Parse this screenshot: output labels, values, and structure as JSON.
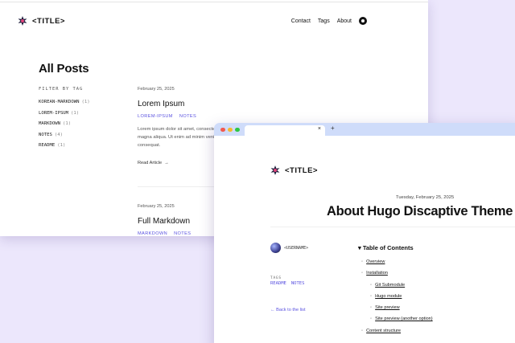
{
  "site": {
    "logo_text": "<TITLE>"
  },
  "back_window": {
    "nav": {
      "items": [
        "Contact",
        "Tags",
        "About"
      ]
    },
    "page_title": "All Posts",
    "filter_title": "FILTER BY TAG",
    "tags": [
      {
        "name": "KOREAN-MARKDOWN",
        "count": "(1)"
      },
      {
        "name": "LOREM-IPSUM",
        "count": "(1)"
      },
      {
        "name": "MARKDOWN",
        "count": "(1)"
      },
      {
        "name": "NOTES",
        "count": "(4)"
      },
      {
        "name": "README",
        "count": "(1)"
      }
    ],
    "posts": [
      {
        "date": "February 25, 2025",
        "title": "Lorem Ipsum",
        "tags": [
          "LOREM-IPSUM",
          "NOTES"
        ],
        "excerpt": "Lorem ipsum dolor sit amet, consectetur adipiscing elit, sed do eiusmod tempor incididunt ut labore et dolore magna aliqua. Ut enim ad minim veniam, quis nostrud exercitation ullamco laboris nisi ut aliquip ex ea commodo consequat.",
        "read_more": "Read Article",
        "arrow": "→"
      },
      {
        "date": "February 25, 2025",
        "title": "Full Markdown",
        "tags": [
          "MARKDOWN",
          "NOTES"
        ]
      }
    ]
  },
  "front_window": {
    "tab": {
      "close": "×",
      "new": "+"
    },
    "date": "Tuesday, February 25, 2025",
    "title": "About Hugo Discaptive Theme",
    "username": "<USERNAME>",
    "tags_label": "TAGS",
    "tags": [
      "README",
      "NOTES"
    ],
    "back_link": "← Back to the list",
    "toc_title": "▾ Table of Contents",
    "toc": [
      {
        "label": "Overview",
        "level": 1
      },
      {
        "label": "Installation",
        "level": 1
      },
      {
        "label": "Git Submodule",
        "level": 2
      },
      {
        "label": "Hugo module",
        "level": 2
      },
      {
        "label": "Site preview",
        "level": 2
      },
      {
        "label": "Site preview (another option)",
        "level": 2
      },
      {
        "label": "Content structure",
        "level": 1
      }
    ]
  },
  "colors": {
    "accent": "#5a52e0",
    "background": "#ece7fc",
    "tabbar": "#cfdcfa"
  }
}
